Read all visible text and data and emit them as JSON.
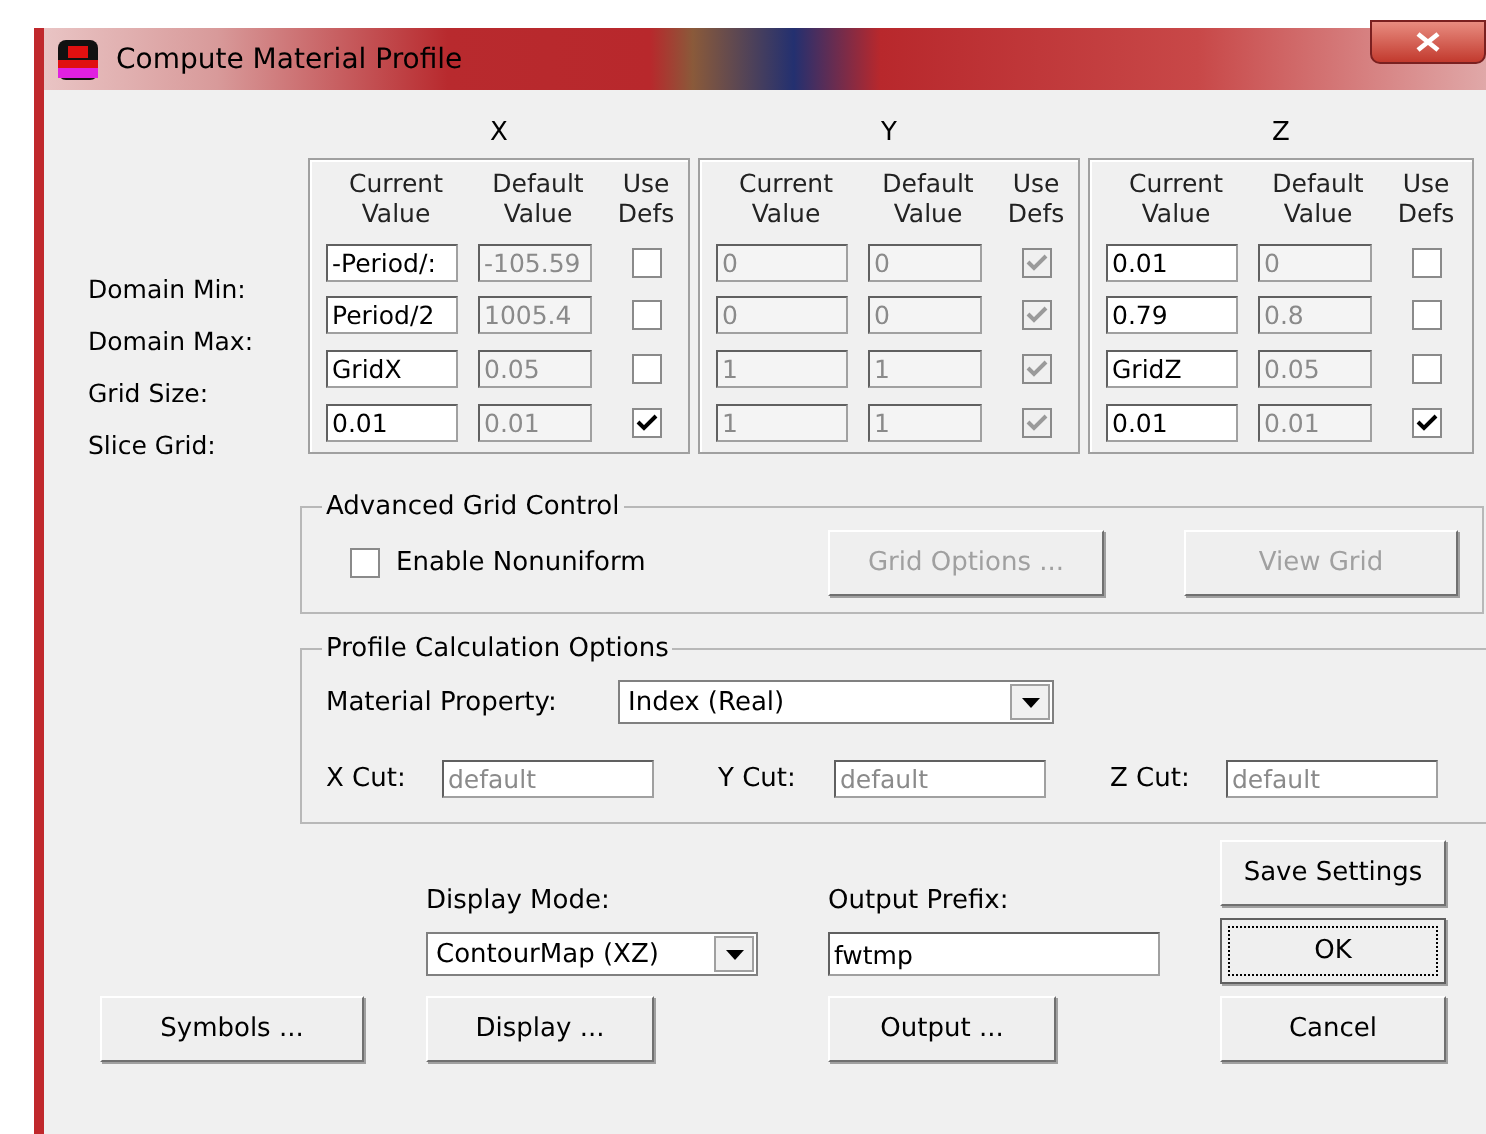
{
  "window": {
    "title": "Compute Material Profile"
  },
  "row_labels": [
    "Domain Min:",
    "Domain Max:",
    "Grid Size:",
    "Slice Grid:"
  ],
  "axes": [
    {
      "label": "X",
      "disabled": false,
      "headers": [
        "Current Value",
        "Default Value",
        "Use Defs"
      ],
      "rows": [
        {
          "current": "-Period/:",
          "default": "-105.59",
          "use_defs": false
        },
        {
          "current": "Period/2",
          "default": "1005.4",
          "use_defs": false
        },
        {
          "current": "GridX",
          "default": "0.05",
          "use_defs": false
        },
        {
          "current": "0.01",
          "default": "0.01",
          "use_defs": true
        }
      ]
    },
    {
      "label": "Y",
      "disabled": true,
      "headers": [
        "Current Value",
        "Default Value",
        "Use Defs"
      ],
      "rows": [
        {
          "current": "0",
          "default": "0",
          "use_defs": true
        },
        {
          "current": "0",
          "default": "0",
          "use_defs": true
        },
        {
          "current": "1",
          "default": "1",
          "use_defs": true
        },
        {
          "current": "1",
          "default": "1",
          "use_defs": true
        }
      ]
    },
    {
      "label": "Z",
      "disabled": false,
      "headers": [
        "Current Value",
        "Default Value",
        "Use Defs"
      ],
      "rows": [
        {
          "current": "0.01",
          "default": "0",
          "use_defs": false
        },
        {
          "current": "0.79",
          "default": "0.8",
          "use_defs": false
        },
        {
          "current": "GridZ",
          "default": "0.05",
          "use_defs": false
        },
        {
          "current": "0.01",
          "default": "0.01",
          "use_defs": true
        }
      ]
    }
  ],
  "advanced": {
    "title": "Advanced Grid Control",
    "enable_nonuniform": {
      "label": "Enable Nonuniform",
      "checked": false
    },
    "buttons": [
      {
        "label": "Grid Options ...",
        "disabled": true
      },
      {
        "label": "View Grid",
        "disabled": true
      }
    ]
  },
  "profile": {
    "title": "Profile Calculation Options",
    "material_property": {
      "label": "Material Property:",
      "value": "Index (Real)"
    },
    "cuts": [
      {
        "label": "X Cut:",
        "placeholder": "default"
      },
      {
        "label": "Y Cut:",
        "placeholder": "default"
      },
      {
        "label": "Z Cut:",
        "placeholder": "default"
      }
    ]
  },
  "display_mode": {
    "label": "Display Mode:",
    "value": "ContourMap (XZ)"
  },
  "output_prefix": {
    "label": "Output Prefix:",
    "value": "fwtmp"
  },
  "buttons": {
    "save": "Save Settings",
    "ok": "OK",
    "cancel": "Cancel",
    "symbols": "Symbols ...",
    "display": "Display ...",
    "output": "Output ..."
  }
}
